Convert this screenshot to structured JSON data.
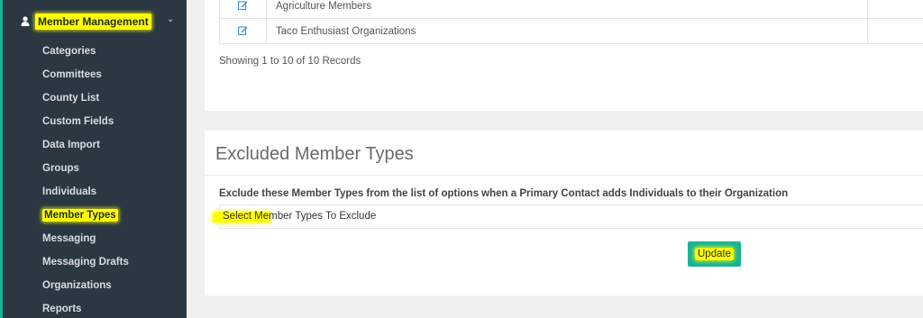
{
  "sidebar": {
    "section_label": "Member Management",
    "items": [
      {
        "label": "Categories"
      },
      {
        "label": "Committees"
      },
      {
        "label": "County List"
      },
      {
        "label": "Custom Fields"
      },
      {
        "label": "Data Import"
      },
      {
        "label": "Groups"
      },
      {
        "label": "Individuals"
      },
      {
        "label": "Member Types"
      },
      {
        "label": "Messaging"
      },
      {
        "label": "Messaging Drafts"
      },
      {
        "label": "Organizations"
      },
      {
        "label": "Reports"
      }
    ],
    "active_item": "Member Types"
  },
  "records_table": {
    "rows": [
      {
        "name": "Agriculture Members"
      },
      {
        "name": "Taco Enthusiast Organizations"
      }
    ],
    "showing_text": "Showing 1 to 10 of 10 Records"
  },
  "excluded_section": {
    "title": "Excluded Member Types",
    "instruction": "Exclude these Member Types from the list of options when a Primary Contact adds Individuals to their Organization",
    "select_placeholder": "Select Member Types To Exclude",
    "update_label": "Update"
  },
  "colors": {
    "sidebar_bg": "#2c3841",
    "accent": "#1ab394",
    "highlight": "#ffff00",
    "edit_icon": "#3a8fd6"
  }
}
